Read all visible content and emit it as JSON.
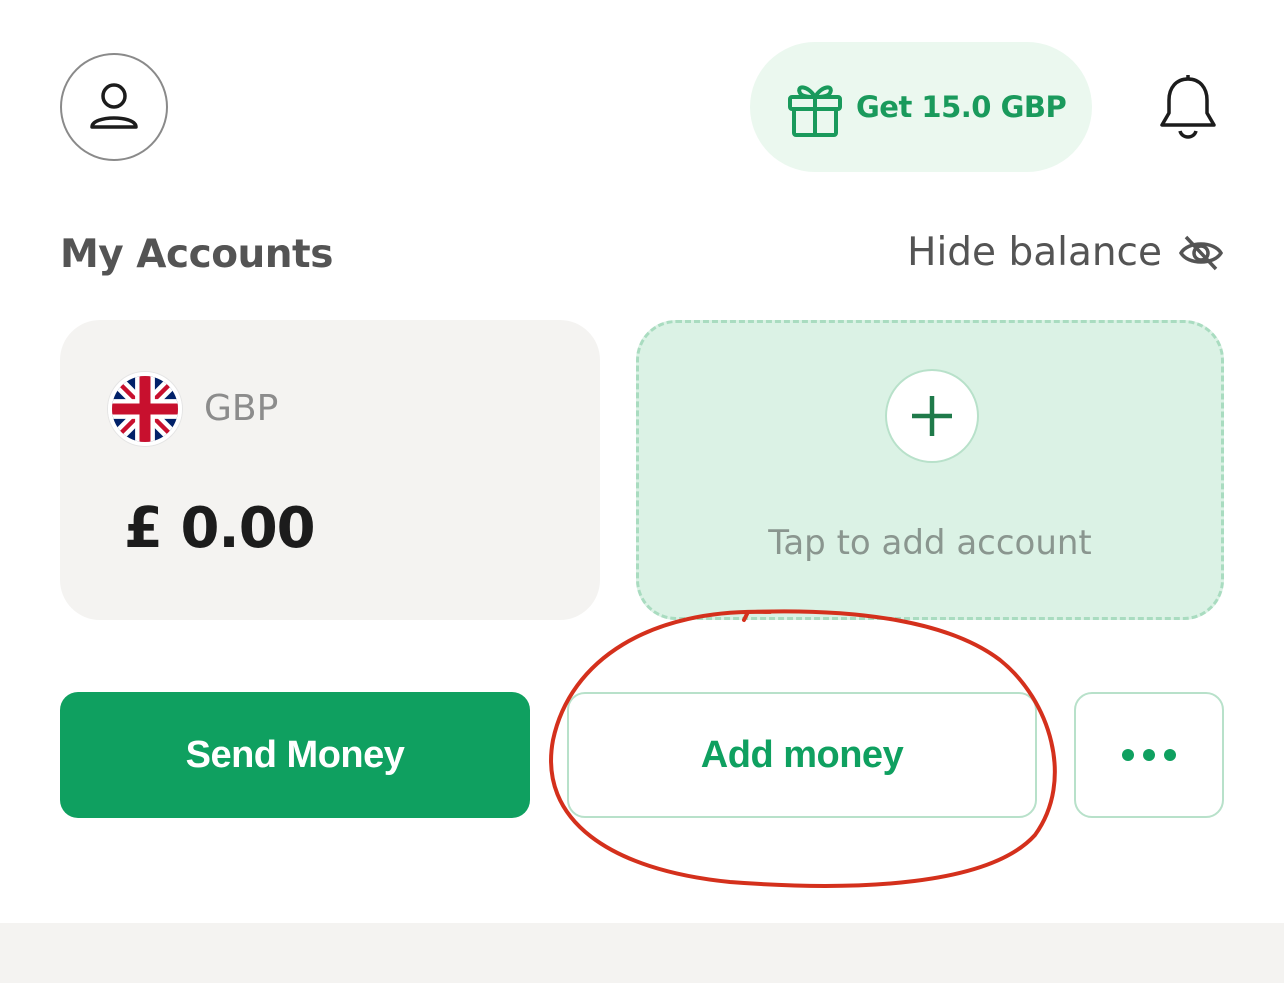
{
  "header": {
    "avatar_icon": "user-icon",
    "promo": {
      "icon": "gift-icon",
      "label": "Get  15.0 GBP"
    },
    "notifications_icon": "bell-icon"
  },
  "accounts": {
    "title": "My Accounts",
    "hide_balance_label": "Hide balance",
    "hide_balance_icon": "eye-off-icon",
    "cards": [
      {
        "flag": "uk-flag-icon",
        "currency": "GBP",
        "balance": "£ 0.00"
      }
    ],
    "add_account": {
      "icon": "plus-icon",
      "label": "Tap to add account"
    }
  },
  "actions": {
    "send_label": "Send Money",
    "add_label": "Add money",
    "more_icon": "more-dots-icon"
  },
  "colors": {
    "brand_green": "#0fa060",
    "promo_bg": "#ebf8ef",
    "add_account_bg": "#dbf2e5",
    "card_bg": "#f4f3f1",
    "annotation_red": "#d4301c"
  }
}
